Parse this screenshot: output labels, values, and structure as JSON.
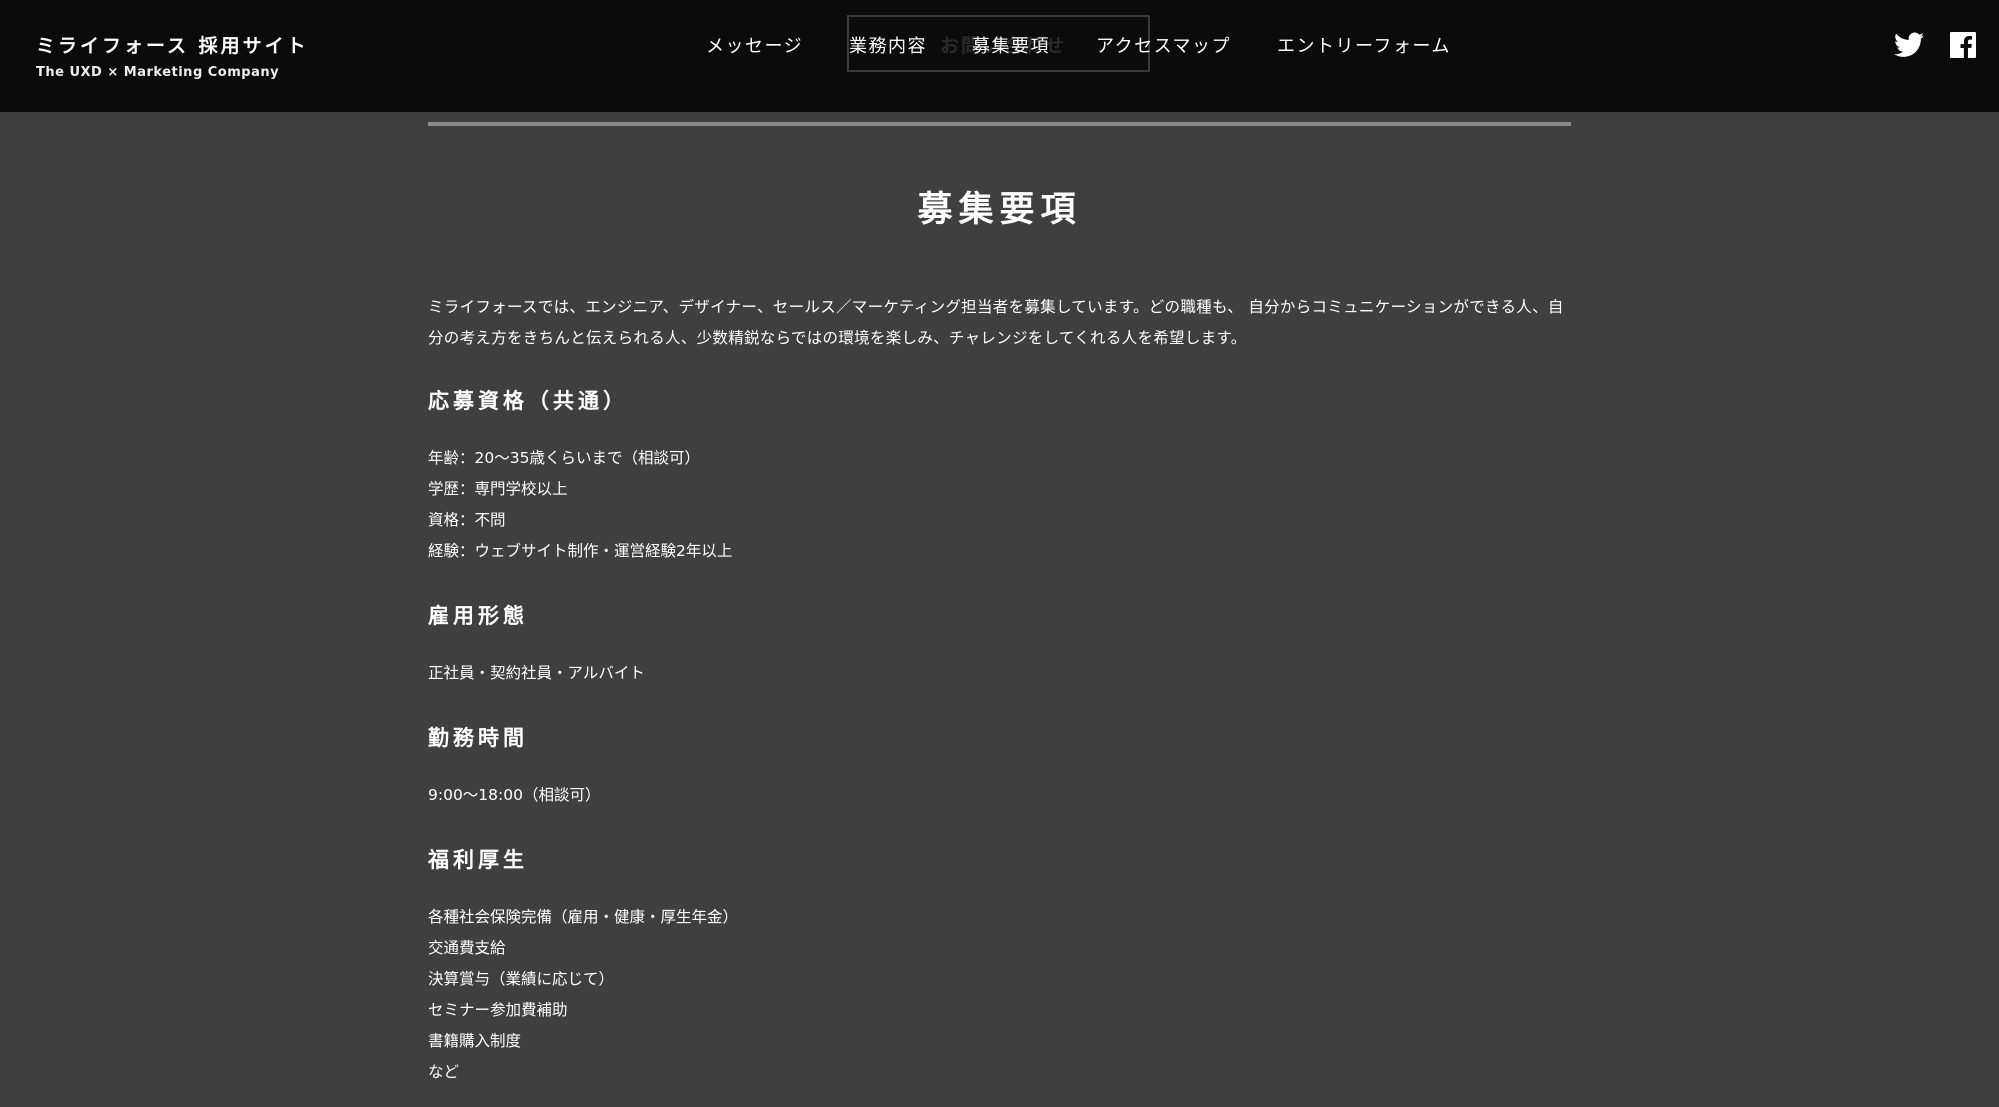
{
  "header": {
    "brand_title": "ミライフォース 採用サイト",
    "brand_subtitle": "The UXD × Marketing Company",
    "ghost_text": "お問い合わせ",
    "nav": [
      {
        "label": "メッセージ"
      },
      {
        "label": "業務内容"
      },
      {
        "label": "募集要項"
      },
      {
        "label": "アクセスマップ"
      },
      {
        "label": "エントリーフォーム"
      }
    ],
    "social": [
      {
        "icon": "twitter-icon"
      },
      {
        "icon": "facebook-icon"
      }
    ]
  },
  "main": {
    "title": "募集要項",
    "intro": "ミライフォースでは、エンジニア、デザイナー、セールス／マーケティング担当者を募集しています。どの職種も、 自分からコミュニケーションができる人、自分の考え方をきちんと伝えられる人、少数精鋭ならではの環境を楽しみ、チャレンジをしてくれる人を希望します。",
    "sections": [
      {
        "heading": "応募資格（共通）",
        "lines": [
          "年齢：20〜35歳くらいまで（相談可）",
          "学歴：専門学校以上",
          "資格：不問",
          "経験：ウェブサイト制作・運営経験2年以上"
        ]
      },
      {
        "heading": "雇用形態",
        "lines": [
          "正社員・契約社員・アルバイト"
        ]
      },
      {
        "heading": "勤務時間",
        "lines": [
          "9:00〜18:00（相談可）"
        ]
      },
      {
        "heading": "福利厚生",
        "lines": [
          "各種社会保険完備（雇用・健康・厚生年金）",
          "交通費支給",
          "決算賞与（業績に応じて）",
          "セミナー参加費補助",
          "書籍購入制度",
          "など"
        ]
      }
    ]
  },
  "colors": {
    "header_bg": "#0b0b0b",
    "page_bg": "#3f3f3f",
    "text": "#ffffff",
    "rule": "#8a8a8a"
  }
}
